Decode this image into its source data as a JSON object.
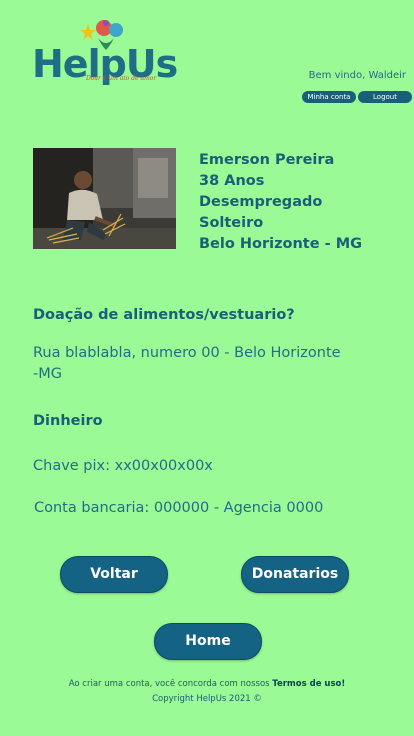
{
  "header": {
    "logo_text": "HelpUs",
    "logo_tagline": "Doar é um ato de amor",
    "welcome": "Bem vindo, Waldeir",
    "account_label": "Minha conta",
    "logout_label": "Logout"
  },
  "profile": {
    "name": "Emerson Pereira",
    "age": "38 Anos",
    "employment": "Desempregado",
    "marital_status": "Solteiro",
    "city": "Belo Horizonte - MG"
  },
  "donation": {
    "goods_heading": "Doação de alimentos/vestuario?",
    "address_line1": "Rua blablabla, numero 00 - Belo Horizonte",
    "address_line2": "-MG",
    "money_heading": "Dinheiro",
    "pix": "Chave pix: xx00x00x00x",
    "bank": "Conta bancaria: 000000 - Agencia 0000"
  },
  "actions": {
    "back_label": "Voltar",
    "donors_label": "Donatarios",
    "home_label": "Home"
  },
  "footer": {
    "terms_prefix": "Ao criar uma conta, você concorda com nossos",
    "terms_link": "Termos de uso!",
    "copyright": "Copyright HelpUs 2021 ©"
  }
}
